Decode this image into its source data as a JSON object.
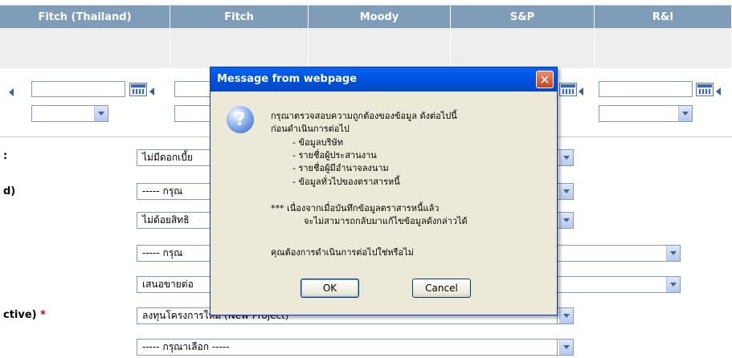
{
  "table": {
    "columns": [
      "Fitch (Thailand)",
      "Fitch",
      "Moody",
      "S&P",
      "R&I"
    ]
  },
  "form": {
    "rows": [
      {
        "label": ":",
        "value": "ไม่มีดอกเบี้ย"
      },
      {
        "label": "d)",
        "value": "----- กรุณ"
      },
      {
        "label": "",
        "value": "ไม่ด้อยสิทธิ"
      },
      {
        "label": "",
        "value": "----- กรุณ"
      },
      {
        "label": "",
        "value": "เสนอขายต่อ"
      },
      {
        "label": "ctive)",
        "value": "ลงทุนโครงการใหม่ (New Project)"
      },
      {
        "label": "",
        "value": "----- กรุณาเลือก -----"
      }
    ],
    "required_mark": "*"
  },
  "dialog": {
    "title": "Message from webpage",
    "close_glyph": "✕",
    "icon": "question-icon",
    "lines": [
      "กรุณาตรวจสอบความถูกต้องของข้อมูล ดังต่อไปนี้",
      "ก่อนดำเนินการต่อไป",
      "- ข้อมูลบริษัท",
      "- รายชื่อผู้ประสานงาน",
      "- รายชื่อผู้มีอำนาจลงนาม",
      "- ข้อมูลทั่วไปของตราสารหนี้",
      "*** เนื่องจากเมื่อบันทึกข้อมูลตราสารหนี้แล้ว",
      "จะไม่สามารถกลับมาแก้ไขข้อมูลดังกล่าวได้",
      "คุณต้องการดำเนินการต่อไปใช่หรือไม่"
    ],
    "ok_label": "OK",
    "cancel_label": "Cancel"
  },
  "colors": {
    "header_bg": "#7f9db9",
    "dialog_title": "#0054e3",
    "required": "#cc0000"
  }
}
